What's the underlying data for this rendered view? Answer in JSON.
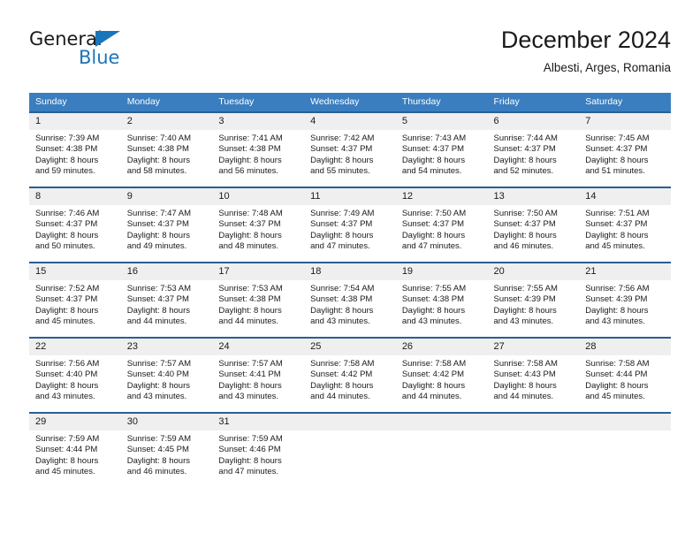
{
  "brand": {
    "name_part1": "General",
    "name_part2": "Blue",
    "accent_color": "#1b75bb"
  },
  "header": {
    "title": "December 2024",
    "subtitle": "Albesti, Arges, Romania"
  },
  "theme": {
    "header_band": "#3a7ebf",
    "row_rule": "#2a5f96",
    "daynum_band": "#efefef"
  },
  "weekday_headers": [
    "Sunday",
    "Monday",
    "Tuesday",
    "Wednesday",
    "Thursday",
    "Friday",
    "Saturday"
  ],
  "weeks": [
    {
      "days": [
        {
          "day": "1",
          "sunrise": "Sunrise: 7:39 AM",
          "sunset": "Sunset: 4:38 PM",
          "daylight_line1": "Daylight: 8 hours",
          "daylight_line2": "and 59 minutes."
        },
        {
          "day": "2",
          "sunrise": "Sunrise: 7:40 AM",
          "sunset": "Sunset: 4:38 PM",
          "daylight_line1": "Daylight: 8 hours",
          "daylight_line2": "and 58 minutes."
        },
        {
          "day": "3",
          "sunrise": "Sunrise: 7:41 AM",
          "sunset": "Sunset: 4:38 PM",
          "daylight_line1": "Daylight: 8 hours",
          "daylight_line2": "and 56 minutes."
        },
        {
          "day": "4",
          "sunrise": "Sunrise: 7:42 AM",
          "sunset": "Sunset: 4:37 PM",
          "daylight_line1": "Daylight: 8 hours",
          "daylight_line2": "and 55 minutes."
        },
        {
          "day": "5",
          "sunrise": "Sunrise: 7:43 AM",
          "sunset": "Sunset: 4:37 PM",
          "daylight_line1": "Daylight: 8 hours",
          "daylight_line2": "and 54 minutes."
        },
        {
          "day": "6",
          "sunrise": "Sunrise: 7:44 AM",
          "sunset": "Sunset: 4:37 PM",
          "daylight_line1": "Daylight: 8 hours",
          "daylight_line2": "and 52 minutes."
        },
        {
          "day": "7",
          "sunrise": "Sunrise: 7:45 AM",
          "sunset": "Sunset: 4:37 PM",
          "daylight_line1": "Daylight: 8 hours",
          "daylight_line2": "and 51 minutes."
        }
      ]
    },
    {
      "days": [
        {
          "day": "8",
          "sunrise": "Sunrise: 7:46 AM",
          "sunset": "Sunset: 4:37 PM",
          "daylight_line1": "Daylight: 8 hours",
          "daylight_line2": "and 50 minutes."
        },
        {
          "day": "9",
          "sunrise": "Sunrise: 7:47 AM",
          "sunset": "Sunset: 4:37 PM",
          "daylight_line1": "Daylight: 8 hours",
          "daylight_line2": "and 49 minutes."
        },
        {
          "day": "10",
          "sunrise": "Sunrise: 7:48 AM",
          "sunset": "Sunset: 4:37 PM",
          "daylight_line1": "Daylight: 8 hours",
          "daylight_line2": "and 48 minutes."
        },
        {
          "day": "11",
          "sunrise": "Sunrise: 7:49 AM",
          "sunset": "Sunset: 4:37 PM",
          "daylight_line1": "Daylight: 8 hours",
          "daylight_line2": "and 47 minutes."
        },
        {
          "day": "12",
          "sunrise": "Sunrise: 7:50 AM",
          "sunset": "Sunset: 4:37 PM",
          "daylight_line1": "Daylight: 8 hours",
          "daylight_line2": "and 47 minutes."
        },
        {
          "day": "13",
          "sunrise": "Sunrise: 7:50 AM",
          "sunset": "Sunset: 4:37 PM",
          "daylight_line1": "Daylight: 8 hours",
          "daylight_line2": "and 46 minutes."
        },
        {
          "day": "14",
          "sunrise": "Sunrise: 7:51 AM",
          "sunset": "Sunset: 4:37 PM",
          "daylight_line1": "Daylight: 8 hours",
          "daylight_line2": "and 45 minutes."
        }
      ]
    },
    {
      "days": [
        {
          "day": "15",
          "sunrise": "Sunrise: 7:52 AM",
          "sunset": "Sunset: 4:37 PM",
          "daylight_line1": "Daylight: 8 hours",
          "daylight_line2": "and 45 minutes."
        },
        {
          "day": "16",
          "sunrise": "Sunrise: 7:53 AM",
          "sunset": "Sunset: 4:37 PM",
          "daylight_line1": "Daylight: 8 hours",
          "daylight_line2": "and 44 minutes."
        },
        {
          "day": "17",
          "sunrise": "Sunrise: 7:53 AM",
          "sunset": "Sunset: 4:38 PM",
          "daylight_line1": "Daylight: 8 hours",
          "daylight_line2": "and 44 minutes."
        },
        {
          "day": "18",
          "sunrise": "Sunrise: 7:54 AM",
          "sunset": "Sunset: 4:38 PM",
          "daylight_line1": "Daylight: 8 hours",
          "daylight_line2": "and 43 minutes."
        },
        {
          "day": "19",
          "sunrise": "Sunrise: 7:55 AM",
          "sunset": "Sunset: 4:38 PM",
          "daylight_line1": "Daylight: 8 hours",
          "daylight_line2": "and 43 minutes."
        },
        {
          "day": "20",
          "sunrise": "Sunrise: 7:55 AM",
          "sunset": "Sunset: 4:39 PM",
          "daylight_line1": "Daylight: 8 hours",
          "daylight_line2": "and 43 minutes."
        },
        {
          "day": "21",
          "sunrise": "Sunrise: 7:56 AM",
          "sunset": "Sunset: 4:39 PM",
          "daylight_line1": "Daylight: 8 hours",
          "daylight_line2": "and 43 minutes."
        }
      ]
    },
    {
      "days": [
        {
          "day": "22",
          "sunrise": "Sunrise: 7:56 AM",
          "sunset": "Sunset: 4:40 PM",
          "daylight_line1": "Daylight: 8 hours",
          "daylight_line2": "and 43 minutes."
        },
        {
          "day": "23",
          "sunrise": "Sunrise: 7:57 AM",
          "sunset": "Sunset: 4:40 PM",
          "daylight_line1": "Daylight: 8 hours",
          "daylight_line2": "and 43 minutes."
        },
        {
          "day": "24",
          "sunrise": "Sunrise: 7:57 AM",
          "sunset": "Sunset: 4:41 PM",
          "daylight_line1": "Daylight: 8 hours",
          "daylight_line2": "and 43 minutes."
        },
        {
          "day": "25",
          "sunrise": "Sunrise: 7:58 AM",
          "sunset": "Sunset: 4:42 PM",
          "daylight_line1": "Daylight: 8 hours",
          "daylight_line2": "and 44 minutes."
        },
        {
          "day": "26",
          "sunrise": "Sunrise: 7:58 AM",
          "sunset": "Sunset: 4:42 PM",
          "daylight_line1": "Daylight: 8 hours",
          "daylight_line2": "and 44 minutes."
        },
        {
          "day": "27",
          "sunrise": "Sunrise: 7:58 AM",
          "sunset": "Sunset: 4:43 PM",
          "daylight_line1": "Daylight: 8 hours",
          "daylight_line2": "and 44 minutes."
        },
        {
          "day": "28",
          "sunrise": "Sunrise: 7:58 AM",
          "sunset": "Sunset: 4:44 PM",
          "daylight_line1": "Daylight: 8 hours",
          "daylight_line2": "and 45 minutes."
        }
      ]
    },
    {
      "days": [
        {
          "day": "29",
          "sunrise": "Sunrise: 7:59 AM",
          "sunset": "Sunset: 4:44 PM",
          "daylight_line1": "Daylight: 8 hours",
          "daylight_line2": "and 45 minutes."
        },
        {
          "day": "30",
          "sunrise": "Sunrise: 7:59 AM",
          "sunset": "Sunset: 4:45 PM",
          "daylight_line1": "Daylight: 8 hours",
          "daylight_line2": "and 46 minutes."
        },
        {
          "day": "31",
          "sunrise": "Sunrise: 7:59 AM",
          "sunset": "Sunset: 4:46 PM",
          "daylight_line1": "Daylight: 8 hours",
          "daylight_line2": "and 47 minutes."
        },
        {
          "day": "",
          "sunrise": "",
          "sunset": "",
          "daylight_line1": "",
          "daylight_line2": ""
        },
        {
          "day": "",
          "sunrise": "",
          "sunset": "",
          "daylight_line1": "",
          "daylight_line2": ""
        },
        {
          "day": "",
          "sunrise": "",
          "sunset": "",
          "daylight_line1": "",
          "daylight_line2": ""
        },
        {
          "day": "",
          "sunrise": "",
          "sunset": "",
          "daylight_line1": "",
          "daylight_line2": ""
        }
      ]
    }
  ]
}
